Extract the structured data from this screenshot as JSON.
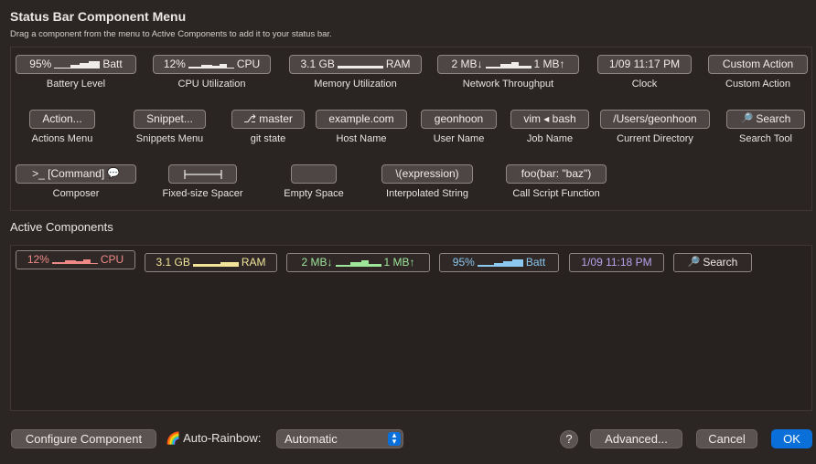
{
  "header": {
    "title": "Status Bar Component Menu",
    "subtitle": "Drag a component from the menu to Active Components to add it to your status bar."
  },
  "menu": {
    "row1": [
      {
        "pill_a": "95%",
        "pill_b": "Batt",
        "label": "Battery Level"
      },
      {
        "pill_a": "12%",
        "pill_b": "CPU",
        "label": "CPU Utilization"
      },
      {
        "pill_a": "3.1 GB",
        "pill_b": "RAM",
        "label": "Memory Utilization"
      },
      {
        "pill_a": "2 MB↓",
        "pill_b": "1 MB↑",
        "label": "Network Throughput"
      },
      {
        "pill": "1/09 11:17 PM",
        "label": "Clock"
      },
      {
        "pill": "Custom Action",
        "label": "Custom Action"
      }
    ],
    "row2": [
      {
        "pill": "Action...",
        "label": "Actions Menu"
      },
      {
        "pill": "Snippet...",
        "label": "Snippets Menu"
      },
      {
        "pill": "⎇ master",
        "label": "git state"
      },
      {
        "pill": "example.com",
        "label": "Host Name"
      },
      {
        "pill": "geonhoon",
        "label": "User Name"
      },
      {
        "pill": "vim ◂ bash",
        "label": "Job Name"
      },
      {
        "pill": "/Users/geonhoon",
        "label": "Current Directory"
      },
      {
        "pill": "Search",
        "label": "Search Tool"
      }
    ],
    "row3": [
      {
        "pill": ">_ [Command]",
        "label": "Composer"
      },
      {
        "pill": "",
        "label": "Fixed-size Spacer"
      },
      {
        "pill": "",
        "label": "Empty Space"
      },
      {
        "pill": "\\(expression)",
        "label": "Interpolated String"
      },
      {
        "pill": "foo(bar: \"baz\")",
        "label": "Call Script Function"
      }
    ]
  },
  "active": {
    "title": "Active Components",
    "items": [
      {
        "a": "12%",
        "b": "CPU",
        "color": "#f08a86"
      },
      {
        "a": "3.1 GB",
        "b": "RAM",
        "color": "#f2e59a"
      },
      {
        "a": "2 MB↓",
        "b": "1 MB↑",
        "color": "#9ee69a"
      },
      {
        "a": "95%",
        "b": "Batt",
        "color": "#8cc8f0"
      },
      {
        "a": "1/09 11:18 PM",
        "color": "#b8a4f0"
      },
      {
        "a": "Search",
        "color": "#efebe8"
      }
    ]
  },
  "footer": {
    "configure": "Configure Component",
    "auto_rainbow_label": "Auto-Rainbow:",
    "auto_rainbow_value": "Automatic",
    "help": "?",
    "advanced": "Advanced...",
    "cancel": "Cancel",
    "ok": "OK"
  },
  "icons": {
    "rainbow": "🌈",
    "search": "🔎",
    "speech": "💬"
  }
}
